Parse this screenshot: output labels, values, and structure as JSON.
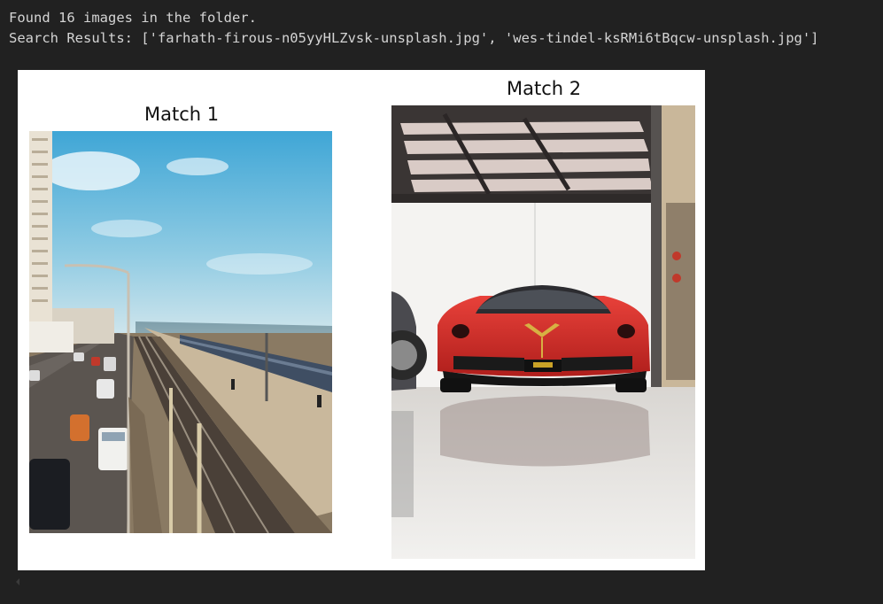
{
  "output": {
    "lines": [
      "Found 16 images in the folder.",
      "Search Results: ['farhath-firous-n05yyHLZvsk-unsplash.jpg', 'wes-tindel-ksRMi6tBqcw-unsplash.jpg']"
    ]
  },
  "figure": {
    "matches": [
      {
        "title": "Match 1",
        "image_subject": "coastal railway beside road and ocean"
      },
      {
        "title": "Match 2",
        "image_subject": "red sports car in garage"
      }
    ]
  },
  "icons": {
    "scroll_left": "chevron-left-icon"
  },
  "colors": {
    "background": "#212121",
    "text": "#d4d4d4",
    "figure_bg": "#ffffff"
  }
}
